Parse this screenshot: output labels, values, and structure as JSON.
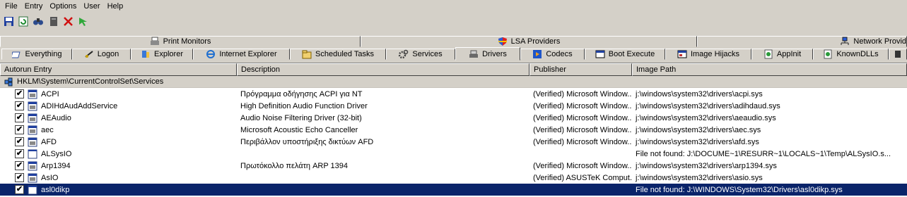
{
  "menu": [
    "File",
    "Entry",
    "Options",
    "User",
    "Help"
  ],
  "tabs_row1": [
    "Print Monitors",
    "LSA Providers",
    "Network Provid"
  ],
  "tabs_row2": [
    "Everything",
    "Logon",
    "Explorer",
    "Internet Explorer",
    "Scheduled Tasks",
    "Services",
    "Drivers",
    "Codecs",
    "Boot Execute",
    "Image Hijacks",
    "AppInit",
    "KnownDLLs"
  ],
  "columns": [
    "Autorun Entry",
    "Description",
    "Publisher",
    "Image Path"
  ],
  "group_label": "HKLM\\System\\CurrentControlSet\\Services",
  "rows": [
    {
      "entry": "ACPI",
      "description": "Πρόγραμμα οδήγησης ACPI για NT",
      "publisher": "(Verified) Microsoft Window...",
      "path": "j:\\windows\\system32\\drivers\\acpi.sys",
      "checked": "✔"
    },
    {
      "entry": "ADIHdAudAddService",
      "description": "High Definition Audio Function Driver",
      "publisher": "(Verified) Microsoft Window...",
      "path": "j:\\windows\\system32\\drivers\\adihdaud.sys",
      "checked": "✔"
    },
    {
      "entry": "AEAudio",
      "description": "Audio Noise Filtering Driver (32-bit)",
      "publisher": "(Verified) Microsoft Window...",
      "path": "j:\\windows\\system32\\drivers\\aeaudio.sys",
      "checked": "✔"
    },
    {
      "entry": "aec",
      "description": "Microsoft Acoustic Echo Canceller",
      "publisher": "(Verified) Microsoft Window...",
      "path": "j:\\windows\\system32\\drivers\\aec.sys",
      "checked": "✔"
    },
    {
      "entry": "AFD",
      "description": "Περιβάλλον υποστήριξης δικτύων AFD",
      "publisher": "(Verified) Microsoft Window...",
      "path": "j:\\windows\\system32\\drivers\\afd.sys",
      "checked": "✔"
    },
    {
      "entry": "ALSysIO",
      "description": "",
      "publisher": "",
      "path": "File not found: J:\\DOCUME~1\\RESURR~1\\LOCALS~1\\Temp\\ALSysIO.s...",
      "checked": "✔"
    },
    {
      "entry": "Arp1394",
      "description": "Πρωτόκολλο πελάτη ARP 1394",
      "publisher": "(Verified) Microsoft Window...",
      "path": "j:\\windows\\system32\\drivers\\arp1394.sys",
      "checked": "✔"
    },
    {
      "entry": "AsIO",
      "description": "",
      "publisher": "(Verified) ASUSTeK Comput...",
      "path": "j:\\windows\\system32\\drivers\\asio.sys",
      "checked": "✔"
    },
    {
      "entry": "asl0dikp",
      "description": "",
      "publisher": "",
      "path": "File not found: J:\\WINDOWS\\System32\\Drivers\\asl0dikp.sys",
      "checked": "✔"
    }
  ],
  "icons": {
    "toolbar": [
      "save-icon",
      "refresh-icon",
      "find-icon",
      "copy-icon",
      "delete-icon",
      "jump-icon"
    ],
    "tabs_row1": [
      "printer-icon",
      "shield-icon",
      "network-icon"
    ],
    "tabs_row2": [
      "everything-icon",
      "logon-icon",
      "explorer-icon",
      "internet-explorer-icon",
      "scheduled-tasks-icon",
      "services-icon",
      "drivers-icon",
      "codecs-icon",
      "boot-execute-icon",
      "image-hijacks-icon",
      "appinit-icon",
      "knowndlls-icon"
    ],
    "row": "driver-file-icon",
    "missing_row": "missing-file-icon"
  },
  "colors": {
    "selection": "#0a246a",
    "chrome": "#d4d0c8"
  }
}
